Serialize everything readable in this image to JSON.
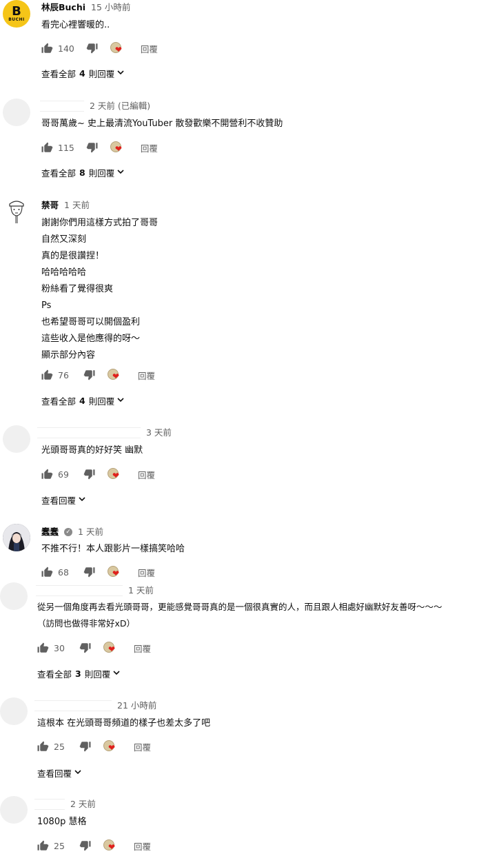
{
  "comments": [
    {
      "author": "林辰Buchi",
      "avatar_text": "B",
      "avatar_sub": "BUCHI",
      "time": "15 小時前",
      "lines": [
        "看完心裡響暖的.."
      ],
      "likes": "140",
      "reply_label": "回覆",
      "replies": {
        "prefix": "查看全部",
        "count": "4",
        "suffix": "則回覆"
      }
    },
    {
      "author": "",
      "time": "2 天前 (已編輯)",
      "lines": [
        "哥哥萬歲~ 史上最清流YouTuber 散發歡樂不開營利不收贊助"
      ],
      "likes": "115",
      "reply_label": "回覆",
      "replies": {
        "prefix": "查看全部",
        "count": "8",
        "suffix": "則回覆"
      }
    },
    {
      "author": "禁哥",
      "time": "1 天前",
      "lines": [
        "謝謝你們用這樣方式拍了哥哥",
        "自然又深刻",
        "真的是很讚捏！",
        "哈哈哈哈哈",
        "粉絲看了覺得很爽",
        "Ps",
        "也希望哥哥可以開個盈利",
        "這些收入是他應得的呀～",
        "顯示部分內容"
      ],
      "likes": "76",
      "reply_label": "回覆",
      "replies": {
        "prefix": "查看全部",
        "count": "4",
        "suffix": "則回覆"
      }
    },
    {
      "author": "",
      "time": "3 天前",
      "lines": [
        "光頭哥哥真的好好笑 幽默"
      ],
      "likes": "69",
      "reply_label": "回覆",
      "replies": {
        "prefix": "查看回覆",
        "count": "",
        "suffix": ""
      }
    },
    {
      "author": "蠢蠢",
      "time": "1 天前",
      "lines": [
        "不推不行！本人跟影片一樣搞笑哈哈"
      ],
      "likes": "68",
      "reply_label": "回覆"
    },
    {
      "author": "",
      "time": "1 天前",
      "lines": [
        "從另一個角度再去看光頭哥哥，更能感覺哥哥真的是一個很真實的人，而且跟人相處好幽默好友善呀～～～",
        "（訪問也做得非常好xD）"
      ],
      "likes": "30",
      "reply_label": "回覆",
      "replies": {
        "prefix": "查看全部",
        "count": "3",
        "suffix": "則回覆"
      }
    },
    {
      "author": "",
      "time": "21 小時前",
      "lines": [
        "這根本 在光頭哥哥頻道的樣子也差太多了吧"
      ],
      "likes": "25",
      "reply_label": "回覆",
      "replies": {
        "prefix": "查看回覆",
        "count": "",
        "suffix": ""
      }
    },
    {
      "author": "",
      "time": "2 天前",
      "lines": [
        "1080p 慧格"
      ],
      "likes": "25",
      "reply_label": "回覆"
    }
  ],
  "icons": {
    "like": "thumbs-up-icon",
    "dislike": "thumbs-down-icon",
    "creator_heart": "creator-heart-icon",
    "verified": "verified-check-icon",
    "chevron": "chevron-down-icon"
  },
  "colors": {
    "heart": "#e0201c",
    "meta_text": "#606060",
    "buchi_avatar": "#f5c518"
  }
}
